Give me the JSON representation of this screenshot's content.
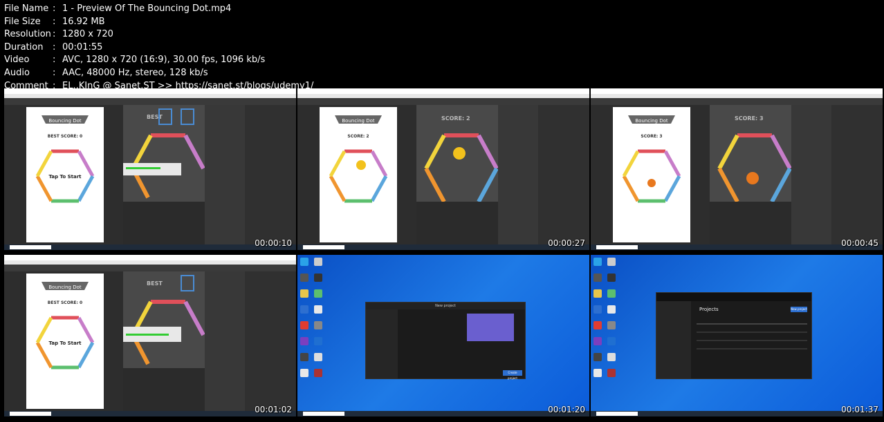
{
  "meta": [
    {
      "key": "File Name",
      "value": "1 - Preview Of The Bouncing Dot.mp4"
    },
    {
      "key": "File Size",
      "value": "16.92 MB"
    },
    {
      "key": "Resolution",
      "value": "1280 x 720"
    },
    {
      "key": "Duration",
      "value": "00:01:55"
    },
    {
      "key": "Video",
      "value": "AVC, 1280 x 720 (16:9), 30.00 fps, 1096 kb/s"
    },
    {
      "key": "Audio",
      "value": "AAC, 48000 Hz, stereo, 128 kb/s"
    },
    {
      "key": "Comment",
      "value": "EL..KInG @ Sanet.ST >> https://sanet.st/blogs/udemy1/"
    }
  ],
  "thumbs": [
    {
      "time": "00:00:10",
      "banner": "Bouncing Dot",
      "score": "BEST SCORE: 0",
      "tap": "Tap To Start",
      "scene_score": "BEST"
    },
    {
      "time": "00:00:27",
      "banner": "Bouncing Dot",
      "score": "SCORE: 2",
      "scene_score": "SCORE: 2"
    },
    {
      "time": "00:00:45",
      "banner": "Bouncing Dot",
      "score": "SCORE: 3",
      "scene_score": "SCORE: 3"
    },
    {
      "time": "00:01:02",
      "banner": "Bouncing Dot",
      "score": "BEST SCORE: 0",
      "tap": "Tap To Start",
      "scene_score": "BEST"
    },
    {
      "time": "00:01:20",
      "hub_title": "New project",
      "hub_btn": "Create project"
    },
    {
      "time": "00:01:37",
      "hub_title": "Projects",
      "hub_btn": "New project"
    }
  ],
  "colors": {
    "yellow": "#f2d43c",
    "red": "#e0505a",
    "purple": "#c77dc9",
    "blue": "#5ba6dc",
    "green": "#5cbf6e",
    "orange": "#f0952f"
  }
}
